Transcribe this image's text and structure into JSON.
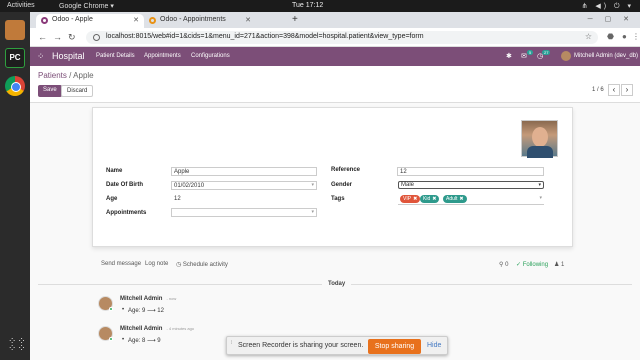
{
  "os": {
    "activities": "Activities",
    "app_name": "Google Chrome",
    "clock": "Tue 17:12"
  },
  "browser": {
    "tabs": [
      {
        "label": "Odoo - Apple"
      },
      {
        "label": "Odoo - Appointments"
      }
    ],
    "url": "localhost:8015/web#id=1&cids=1&menu_id=271&action=398&model=hospital.patient&view_type=form"
  },
  "odoo": {
    "app": "Hospital",
    "menu": [
      "Patient Details",
      "Appointments",
      "Configurations"
    ],
    "badges": [
      "5",
      "27"
    ],
    "user": "Mitchell Admin (dev_db)"
  },
  "control": {
    "breadcrumb_parent": "Patients",
    "breadcrumb_sep": "/",
    "breadcrumb_current": "Apple",
    "save": "Save",
    "discard": "Discard",
    "pager": "1 / 6"
  },
  "form": {
    "name_label": "Name",
    "name_value": "Apple",
    "dob_label": "Date Of Birth",
    "dob_value": "01/02/2010",
    "age_label": "Age",
    "age_value": "12",
    "appointments_label": "Appointments",
    "appointments_value": "",
    "reference_label": "Reference",
    "reference_value": "12",
    "gender_label": "Gender",
    "gender_value": "Male",
    "tags_label": "Tags",
    "tags": [
      {
        "label": "VIP",
        "color": "#e0553a"
      },
      {
        "label": "Kid",
        "color": "#2e9a8c"
      },
      {
        "label": "Adult",
        "color": "#2e9a8c"
      }
    ]
  },
  "chatter": {
    "send_message": "Send message",
    "log_note": "Log note",
    "schedule_activity": "Schedule activity",
    "attachments": "0",
    "following": "Following",
    "followers": "1",
    "today": "Today",
    "messages": [
      {
        "author": "Mitchell Admin",
        "date": "- now",
        "change": "Age: 9 ⟶ 12"
      },
      {
        "author": "Mitchell Admin",
        "date": "- 4 minutes ago",
        "change": "Age: 8 ⟶ 9"
      }
    ]
  },
  "notification": {
    "text": "Screen Recorder is sharing your screen.",
    "stop": "Stop sharing",
    "hide": "Hide"
  },
  "colors": {
    "odoo_purple": "#7c4e78",
    "stop_orange": "#e8711c"
  }
}
